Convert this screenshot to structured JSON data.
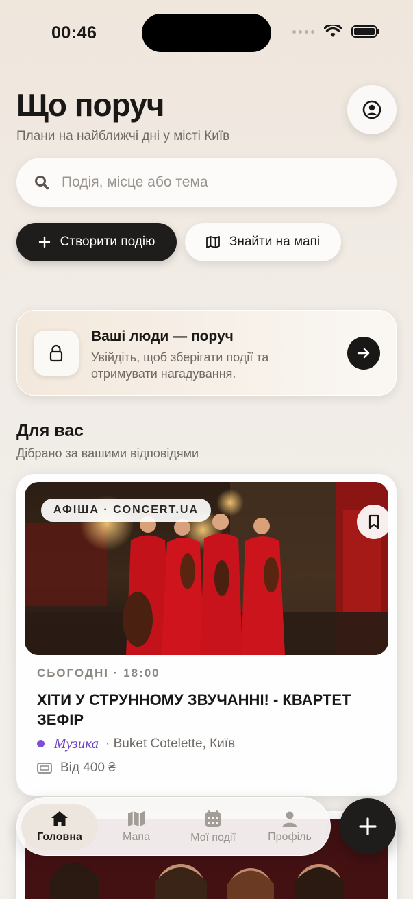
{
  "status_bar": {
    "time": "00:46"
  },
  "header": {
    "title": "Що поруч",
    "subtitle": "Плани на найближчі дні у місті Київ"
  },
  "search": {
    "placeholder": "Подія, місце або тема",
    "value": ""
  },
  "actions": {
    "create_label": "Створити подію",
    "map_label": "Знайти на мапі"
  },
  "login_card": {
    "title": "Ваші люди — поруч",
    "text": "Увійдіть, щоб зберігати події та отримувати нагадування."
  },
  "for_you": {
    "title": "Для вас",
    "subtitle": "Дібрано за вашими відповідями"
  },
  "events": [
    {
      "source": "АФІША · CONCERT.UA",
      "datetime": "СЬОГОДНІ · 18:00",
      "title": "ХІТИ У СТРУННОМУ ЗВУЧАННІ! - КВАРТЕТ ЗЕФІР",
      "category": "Музика",
      "venue": "· Buket Cotelette, Київ",
      "price": "Від 400 ₴",
      "category_color": "#7c4fd8"
    }
  ],
  "tab_bar": {
    "tabs": [
      {
        "label": "Головна",
        "icon": "home-icon",
        "active": true
      },
      {
        "label": "Мапа",
        "icon": "map-icon",
        "active": false
      },
      {
        "label": "Мої події",
        "icon": "calendar-icon",
        "active": false
      },
      {
        "label": "Профіль",
        "icon": "person-icon",
        "active": false
      }
    ]
  },
  "colors": {
    "accent_dark": "#1f1d1b",
    "background": "#f1ece6",
    "category_purple": "#7c4fd8",
    "muted_text": "#6f6a65"
  }
}
